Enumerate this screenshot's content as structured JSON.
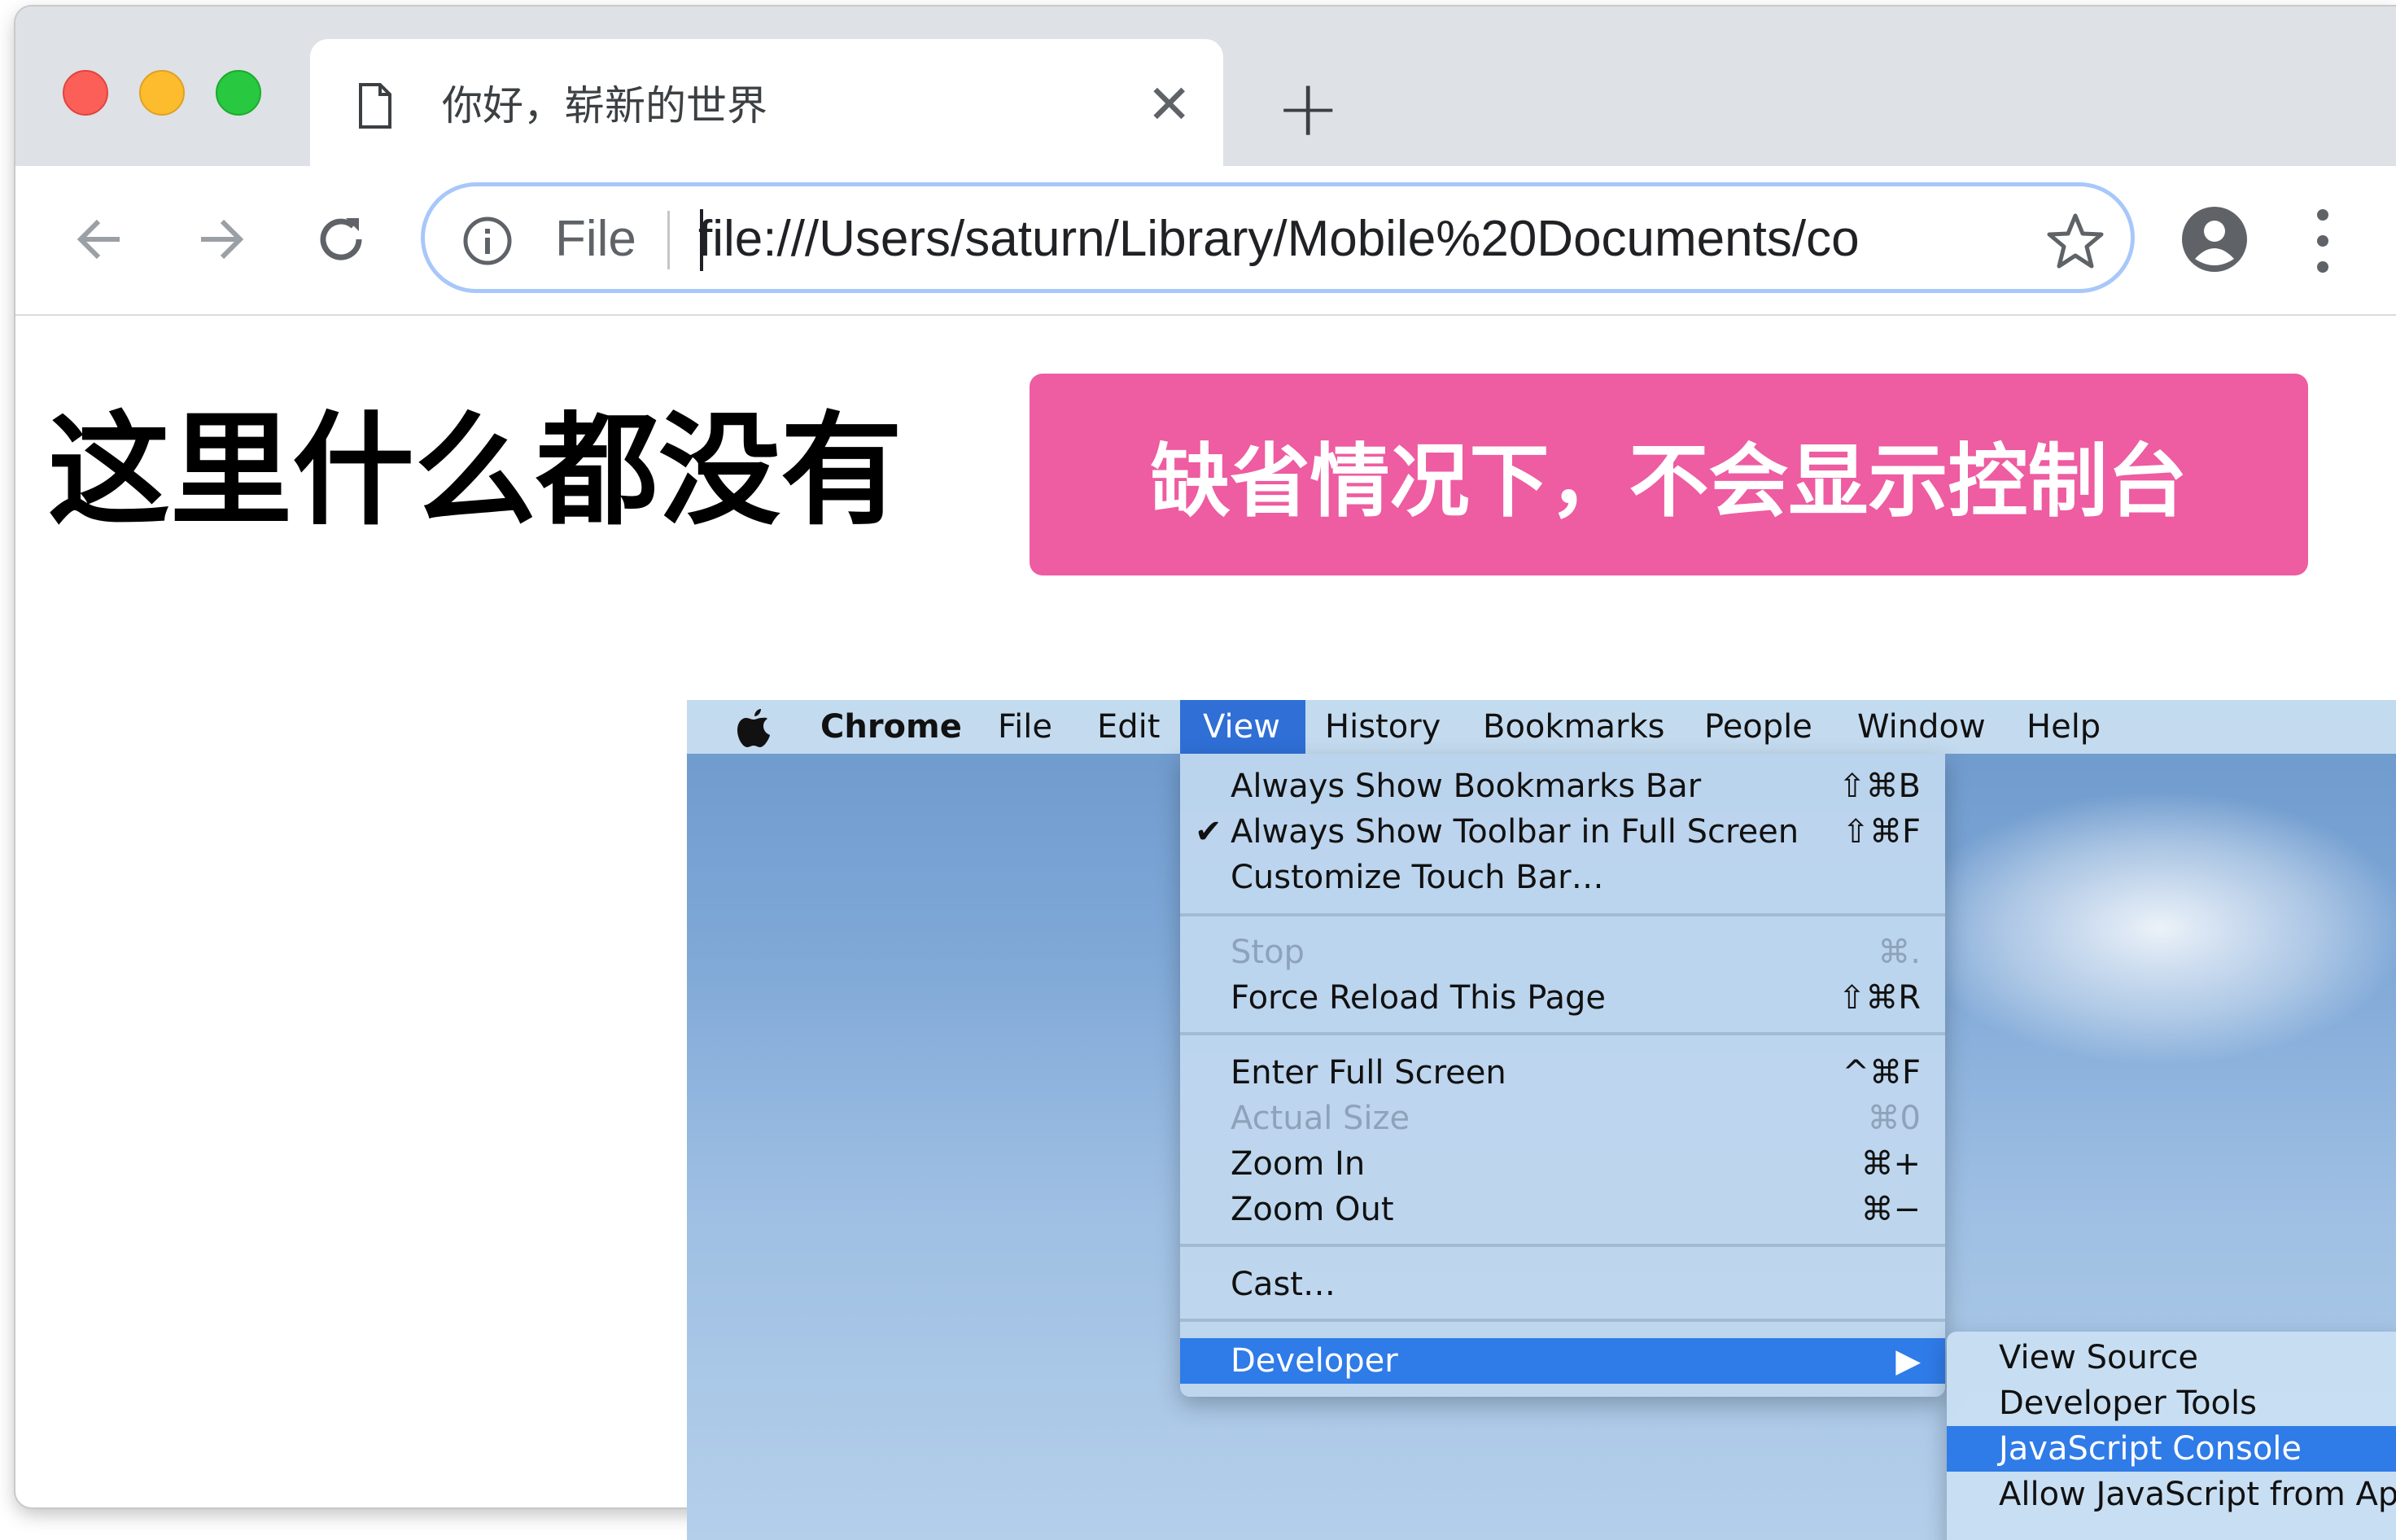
{
  "tab": {
    "title": "你好，崭新的世界",
    "close_symbol": "✕",
    "new_tab_symbol": "+"
  },
  "omnibox": {
    "scheme_label": "File",
    "url": "file:///Users/saturn/Library/Mobile%20Documents/co"
  },
  "page": {
    "heading": "这里什么都没有"
  },
  "callout": {
    "text": "缺省情况下，不会显示控制台",
    "color": "#ee5ca1"
  },
  "menubar": {
    "app_name": "Chrome",
    "items": [
      "File",
      "Edit",
      "View",
      "History",
      "Bookmarks",
      "People",
      "Window",
      "Help"
    ],
    "active": "View"
  },
  "view_menu": {
    "items": [
      {
        "label": "Always Show Bookmarks Bar",
        "shortcut": "⇧⌘B"
      },
      {
        "label": "Always Show Toolbar in Full Screen",
        "shortcut": "⇧⌘F",
        "checked": "✔"
      },
      {
        "label": "Customize Touch Bar…",
        "shortcut": ""
      },
      {
        "label": "Stop",
        "shortcut": "⌘.",
        "disabled": true
      },
      {
        "label": "Force Reload This Page",
        "shortcut": "⇧⌘R"
      },
      {
        "label": "Enter Full Screen",
        "shortcut": "^⌘F"
      },
      {
        "label": "Actual Size",
        "shortcut": "⌘0",
        "disabled": true
      },
      {
        "label": "Zoom In",
        "shortcut": "⌘+"
      },
      {
        "label": "Zoom Out",
        "shortcut": "⌘−"
      },
      {
        "label": "Cast…",
        "shortcut": ""
      },
      {
        "label": "Developer",
        "shortcut": "▶",
        "highlighted": true
      }
    ]
  },
  "developer_submenu": {
    "items": [
      {
        "label": "View Source"
      },
      {
        "label": "Developer Tools"
      },
      {
        "label": "JavaScript Console",
        "highlighted": true
      },
      {
        "label": "Allow JavaScript from Ap"
      }
    ]
  },
  "colors": {
    "highlight": "#2f7be8",
    "tabstrip": "#dee1e6",
    "omnibox_focus": "#a8c7fa"
  }
}
